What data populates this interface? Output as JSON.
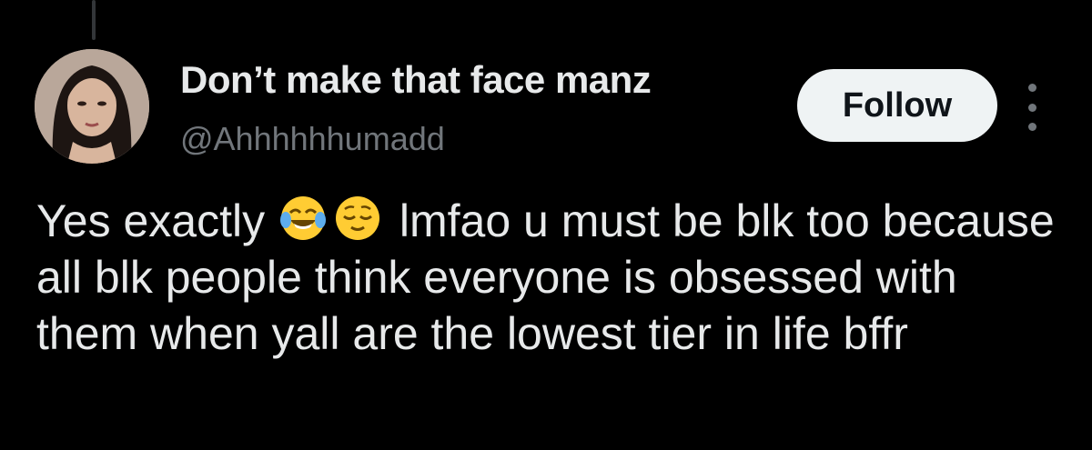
{
  "tweet": {
    "author": {
      "display_name": "Don’t make that face manz",
      "handle": "@Ahhhhhhumadd"
    },
    "follow_label": "Follow",
    "text_before_emoji": "Yes exactly ",
    "emojis": [
      "face-with-tears-of-joy-icon",
      "relieved-face-icon"
    ],
    "text_after_emoji": " lmfao u must be blk too because all blk people think everyone is obsessed with them when yall are the lowest tier in life bffr"
  },
  "colors": {
    "background": "#000000",
    "primary_text": "#e7e9ea",
    "secondary_text": "#71767b",
    "follow_button_bg": "#eff3f4",
    "follow_button_text": "#0f1419"
  }
}
